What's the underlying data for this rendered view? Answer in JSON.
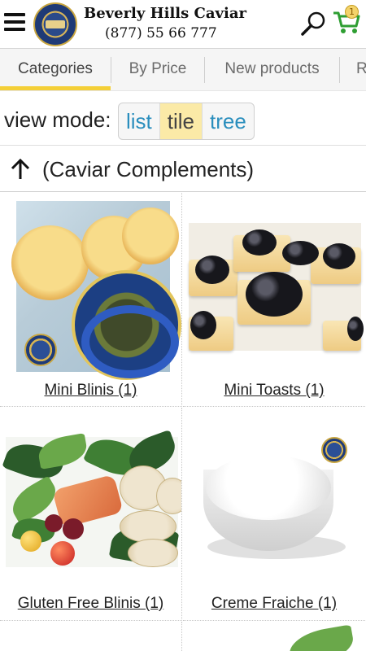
{
  "header": {
    "menu_icon": "hamburger-menu-icon",
    "brand_name": "Beverly Hills Caviar",
    "phone": "(877) 55 66 777",
    "search_icon": "search-icon",
    "cart_icon": "cart-icon",
    "cart_count": "1",
    "accent_color": "#f4cf37"
  },
  "tabs": [
    {
      "label": "Categories",
      "active": true
    },
    {
      "label": "By Price",
      "active": false
    },
    {
      "label": "New products",
      "active": false
    },
    {
      "label": "R",
      "active": false
    }
  ],
  "view_mode": {
    "label": "view mode:",
    "options": [
      "list",
      "tile",
      "tree"
    ],
    "selected": "tile"
  },
  "breadcrumb": {
    "icon": "arrow-up-icon",
    "text": "(Caviar Complements)"
  },
  "products": [
    {
      "label": "Mini Blinis (1)"
    },
    {
      "label": "Mini Toasts (1)"
    },
    {
      "label": "Gluten Free Blinis (1)"
    },
    {
      "label": "Creme Fraiche (1)"
    }
  ]
}
